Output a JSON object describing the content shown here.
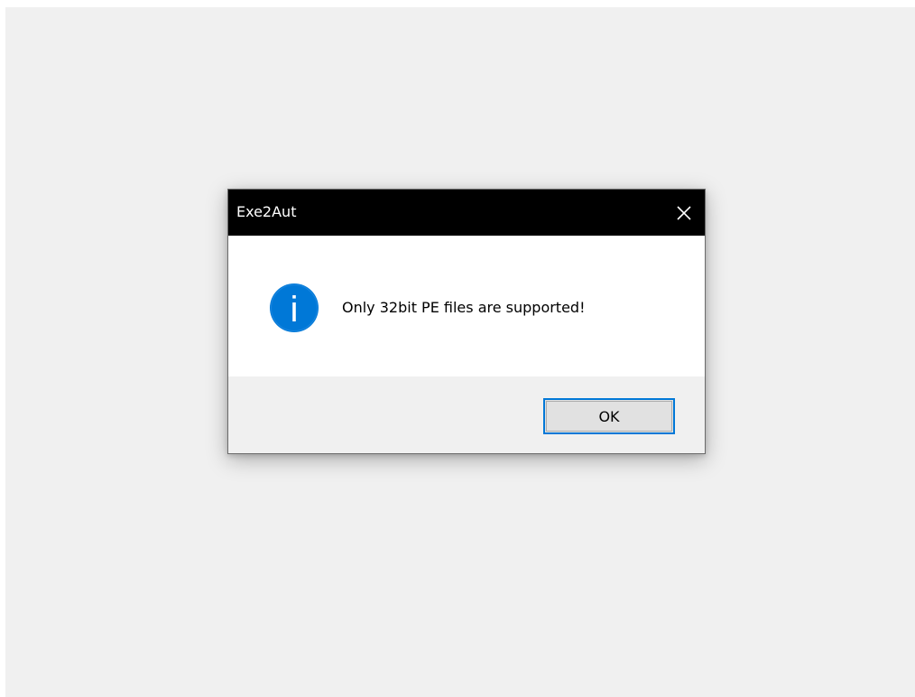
{
  "dialog": {
    "title": "Exe2Aut",
    "message": "Only 32bit PE files are supported!",
    "icon": "info-icon",
    "ok_label": "OK",
    "close_icon": "close-icon"
  },
  "colors": {
    "desktop_background": "#f0f0f0",
    "titlebar": "#000000",
    "icon_blue": "#0078d7",
    "button_focus_border": "#0078d7",
    "button_fill": "#e1e1e1"
  }
}
